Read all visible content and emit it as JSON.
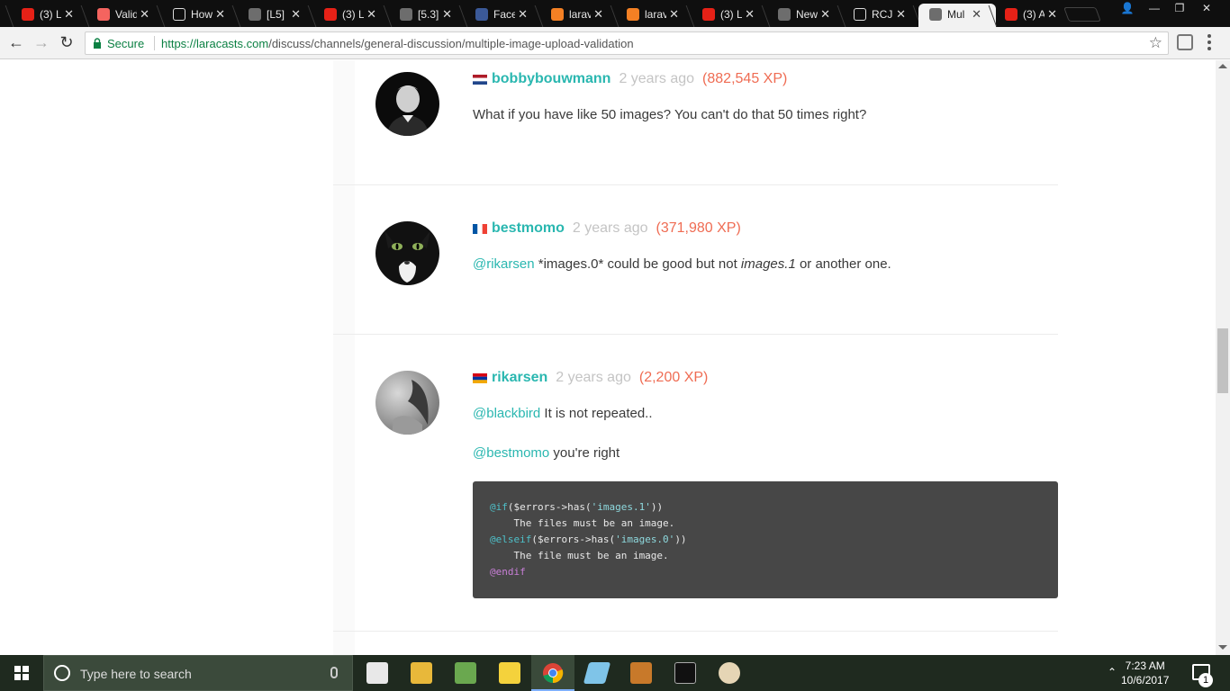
{
  "browser": {
    "tabs": [
      {
        "title": "(3) L",
        "favicon": "youtube-icon",
        "color": "#e62117"
      },
      {
        "title": "Valid",
        "favicon": "laravel-icon",
        "color": "#f4645f"
      },
      {
        "title": "How",
        "favicon": "page-icon",
        "color": "#ffffff"
      },
      {
        "title": "[L5]",
        "favicon": "laracasts-icon",
        "color": "#6d6d6d"
      },
      {
        "title": "(3) L",
        "favicon": "youtube-icon",
        "color": "#e62117"
      },
      {
        "title": "[5.3]",
        "favicon": "github-icon",
        "color": "#6d6d6d"
      },
      {
        "title": "Face",
        "favicon": "facebook-icon",
        "color": "#3b5998"
      },
      {
        "title": "larav",
        "favicon": "stackoverflow-icon",
        "color": "#f48024"
      },
      {
        "title": "larav",
        "favicon": "stackoverflow-icon",
        "color": "#f48024"
      },
      {
        "title": "(3) L",
        "favicon": "youtube-icon",
        "color": "#e62117"
      },
      {
        "title": "New",
        "favicon": "laracasts-icon",
        "color": "#6d6d6d"
      },
      {
        "title": "RCJ",
        "favicon": "page-icon",
        "color": "#ffffff"
      },
      {
        "title": "Mul",
        "favicon": "laracasts-icon",
        "color": "#6d6d6d",
        "active": true
      },
      {
        "title": "(3) A",
        "favicon": "youtube-icon",
        "color": "#e62117"
      }
    ],
    "secure_label": "Secure",
    "url_host": "https://laracasts.com",
    "url_path": "/discuss/channels/general-discussion/multiple-image-upload-validation"
  },
  "replies": [
    {
      "username": "bobbybouwmann",
      "ago": "2 years ago",
      "xp": "(882,545 XP)",
      "flag": "netherlands-flag",
      "body": "What if you have like 50 images? You can't do that 50 times right?"
    },
    {
      "username": "bestmomo",
      "ago": "2 years ago",
      "xp": "(371,980 XP)",
      "flag": "france-flag",
      "mention": "@rikarsen",
      "body_part1": " *images.0* could be good but not ",
      "body_em": "images.1",
      "body_part2": " or another one."
    },
    {
      "username": "rikarsen",
      "ago": "2 years ago",
      "xp": "(2,200 XP)",
      "flag": "armenia-flag",
      "line1_mention": "@blackbird",
      "line1_text": " It is not repeated..",
      "line2_mention": "@bestmomo",
      "line2_text": " you're right",
      "code": {
        "l1_kw": "@if",
        "l1_a": "($errors->has(",
        "l1_str": "'images.1'",
        "l1_b": "))",
        "l2": "    The files must be an image.",
        "l3_kw": "@elseif",
        "l3_a": "($errors->has(",
        "l3_str": "'images.0'",
        "l3_b": "))",
        "l4": "    The file must be an image.",
        "l5_kw": "@endif"
      }
    }
  ],
  "taskbar": {
    "search_placeholder": "Type here to search",
    "time": "7:23 AM",
    "date": "10/6/2017",
    "notification_count": "1",
    "apps": [
      "mail-icon",
      "file-explorer-icon",
      "spreadsheet-icon",
      "sticky-notes-icon",
      "chrome-icon",
      "app-icon",
      "sublime-text-icon",
      "terminal-icon",
      "paint-icon"
    ]
  }
}
